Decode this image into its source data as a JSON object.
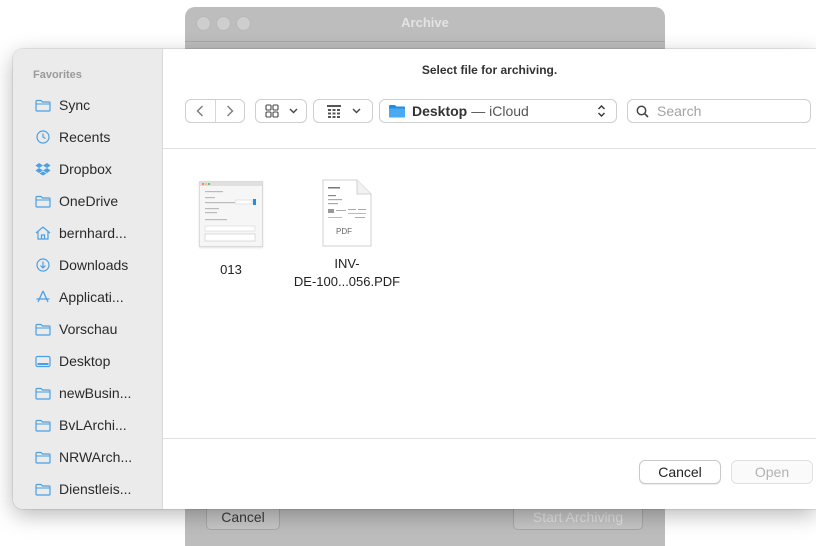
{
  "background_window": {
    "title": "Archive",
    "cancel_label": "Cancel",
    "start_label": "Start Archiving"
  },
  "dialog": {
    "title": "Select file for archiving."
  },
  "sidebar": {
    "header": "Favorites",
    "items": [
      {
        "label": "Sync",
        "icon": "folder-icon"
      },
      {
        "label": "Recents",
        "icon": "clock-icon"
      },
      {
        "label": "Dropbox",
        "icon": "dropbox-icon"
      },
      {
        "label": "OneDrive",
        "icon": "folder-icon"
      },
      {
        "label": "bernhard...",
        "icon": "home-icon"
      },
      {
        "label": "Downloads",
        "icon": "download-icon"
      },
      {
        "label": "Applicati...",
        "icon": "applications-icon"
      },
      {
        "label": "Vorschau",
        "icon": "folder-icon"
      },
      {
        "label": "Desktop",
        "icon": "desktop-icon"
      },
      {
        "label": "newBusin...",
        "icon": "folder-icon"
      },
      {
        "label": "BvLArchi...",
        "icon": "folder-icon"
      },
      {
        "label": "NRWArch...",
        "icon": "folder-icon"
      },
      {
        "label": "Dienstleis...",
        "icon": "folder-icon"
      }
    ]
  },
  "toolbar": {
    "location_name": "Desktop",
    "location_sub": "— iCloud",
    "search_placeholder": "Search"
  },
  "files": [
    {
      "name": "013",
      "kind": "png-thumbnail"
    },
    {
      "name_line1": "INV-",
      "name_line2": "DE-100...056.PDF",
      "kind": "pdf",
      "badge": "PDF"
    }
  ],
  "buttons": {
    "cancel": "Cancel",
    "open": "Open"
  },
  "colors": {
    "accent": "#1e8ee6",
    "sidebar_icon": "#4a9fe6",
    "sidebar_bg": "#ebebeb"
  }
}
